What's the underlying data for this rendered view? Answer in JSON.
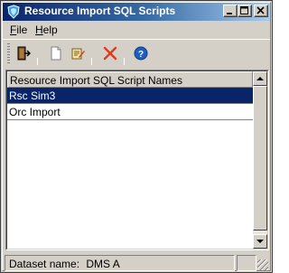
{
  "window": {
    "title": "Resource Import SQL Scripts",
    "title_icon": "app-shield-icon"
  },
  "menu": {
    "file": {
      "accel": "F",
      "rest": "ile"
    },
    "help": {
      "accel": "H",
      "rest": "elp"
    }
  },
  "toolbar": {
    "icons": [
      "exit-door-icon",
      "new-document-icon",
      "edit-document-icon",
      "delete-x-icon",
      "help-icon"
    ]
  },
  "list": {
    "column_header": "Resource Import SQL Script Names",
    "rows": [
      {
        "label": "Rsc Sim3",
        "selected": true
      },
      {
        "label": "Orc Import",
        "selected": false
      }
    ]
  },
  "status": {
    "dataset_label": "Dataset name:",
    "dataset_value": "DMS A"
  },
  "colors": {
    "title_gradient_start": "#0a246a",
    "title_gradient_end": "#a6caf0",
    "selection": "#0a246a",
    "face": "#d4d0c8",
    "delete_red": "#e03a1e",
    "help_blue": "#1f5fbf"
  }
}
